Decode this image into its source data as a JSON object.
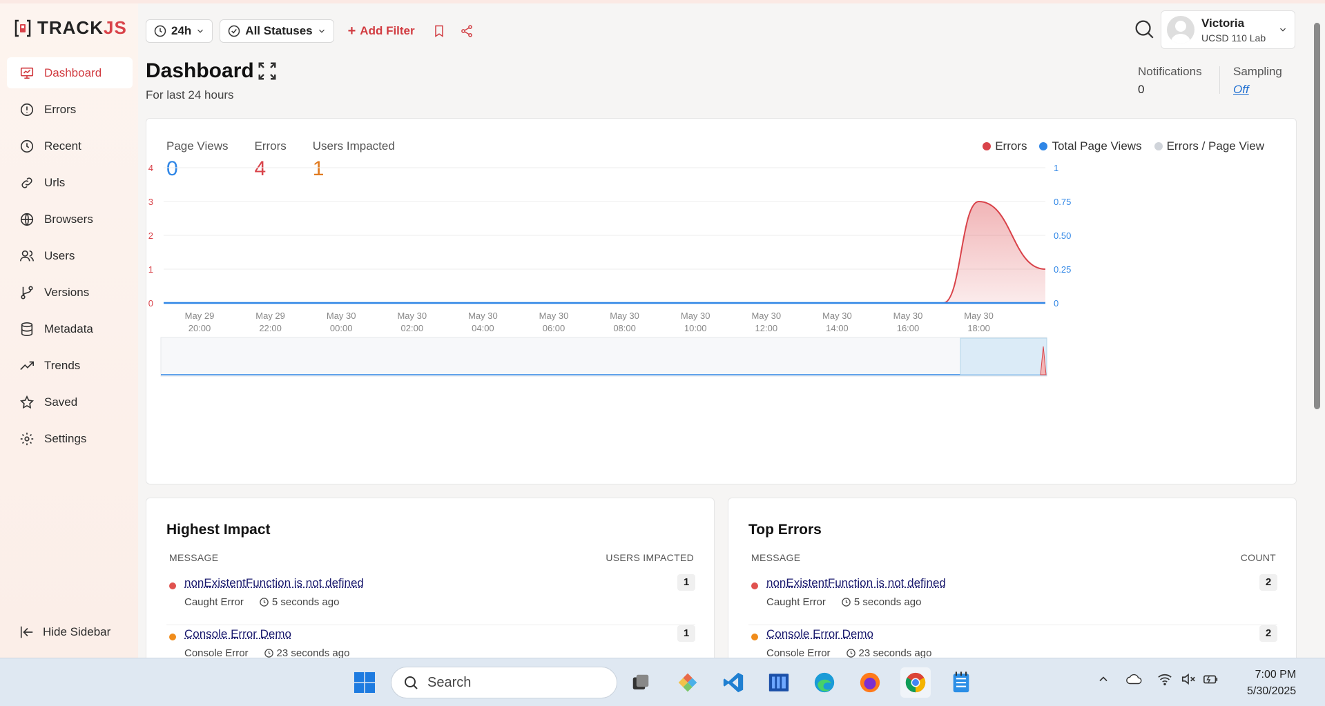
{
  "app": {
    "logo_text": "TRACK",
    "logo_text_accent": "JS"
  },
  "sidebar": {
    "items": [
      {
        "label": "Dashboard",
        "icon": "presentation-chart-icon",
        "active": true
      },
      {
        "label": "Errors",
        "icon": "alert-circle-icon",
        "active": false
      },
      {
        "label": "Recent",
        "icon": "clock-icon",
        "active": false
      },
      {
        "label": "Urls",
        "icon": "link-icon",
        "active": false
      },
      {
        "label": "Browsers",
        "icon": "globe-icon",
        "active": false
      },
      {
        "label": "Users",
        "icon": "users-icon",
        "active": false
      },
      {
        "label": "Versions",
        "icon": "git-branch-icon",
        "active": false
      },
      {
        "label": "Metadata",
        "icon": "database-icon",
        "active": false
      },
      {
        "label": "Trends",
        "icon": "trending-up-icon",
        "active": false
      },
      {
        "label": "Saved",
        "icon": "star-icon",
        "active": false
      },
      {
        "label": "Settings",
        "icon": "gear-icon",
        "active": false
      }
    ],
    "hide_label": "Hide Sidebar"
  },
  "toolbar": {
    "time_range": "24h",
    "status_filter": "All Statuses",
    "add_filter_label": "Add Filter"
  },
  "user": {
    "name": "Victoria",
    "org": "UCSD 110 Lab"
  },
  "header": {
    "title": "Dashboard",
    "subtitle": "For last 24 hours",
    "notifications_label": "Notifications",
    "notifications_value": "0",
    "sampling_label": "Sampling",
    "sampling_value": "Off"
  },
  "stats": {
    "page_views_label": "Page Views",
    "page_views_value": "0",
    "errors_label": "Errors",
    "errors_value": "4",
    "users_label": "Users Impacted",
    "users_value": "1"
  },
  "legend": {
    "errors": "Errors",
    "page_views": "Total Page Views",
    "ratio": "Errors / Page View"
  },
  "colors": {
    "accent": "#d13b40",
    "errors": "#d9434a",
    "page_views": "#2f86e6",
    "users": "#e07a1f",
    "ratio": "#d0d4da"
  },
  "chart_data": {
    "type": "area",
    "x": [
      "May 29 20:00",
      "May 29 22:00",
      "May 30 00:00",
      "May 30 02:00",
      "May 30 04:00",
      "May 30 06:00",
      "May 30 08:00",
      "May 30 10:00",
      "May 30 12:00",
      "May 30 14:00",
      "May 30 16:00",
      "May 30 17:00",
      "May 30 18:00",
      "May 30 19:00"
    ],
    "tick_labels": [
      {
        "top": "May 29",
        "bottom": "20:00"
      },
      {
        "top": "May 29",
        "bottom": "22:00"
      },
      {
        "top": "May 30",
        "bottom": "00:00"
      },
      {
        "top": "May 30",
        "bottom": "02:00"
      },
      {
        "top": "May 30",
        "bottom": "04:00"
      },
      {
        "top": "May 30",
        "bottom": "06:00"
      },
      {
        "top": "May 30",
        "bottom": "08:00"
      },
      {
        "top": "May 30",
        "bottom": "10:00"
      },
      {
        "top": "May 30",
        "bottom": "12:00"
      },
      {
        "top": "May 30",
        "bottom": "14:00"
      },
      {
        "top": "May 30",
        "bottom": "16:00"
      },
      {
        "top": "May 30",
        "bottom": "18:00"
      }
    ],
    "series": [
      {
        "name": "Errors",
        "axis": "left",
        "values": [
          0,
          0,
          0,
          0,
          0,
          0,
          0,
          0,
          0,
          0,
          0,
          0,
          3,
          1
        ]
      },
      {
        "name": "Total Page Views",
        "axis": "right",
        "values": [
          0,
          0,
          0,
          0,
          0,
          0,
          0,
          0,
          0,
          0,
          0,
          0,
          0,
          0
        ]
      }
    ],
    "y_left": {
      "ticks": [
        "0",
        "1",
        "2",
        "3",
        "4"
      ],
      "range": [
        0,
        4
      ]
    },
    "y_right": {
      "ticks": [
        "0",
        "0.25",
        "0.50",
        "0.75",
        "1"
      ],
      "range": [
        0,
        1
      ]
    },
    "grid": true,
    "legend_position": "top-right"
  },
  "highest_impact": {
    "title": "Highest Impact",
    "col_message": "MESSAGE",
    "col_value": "USERS IMPACTED",
    "rows": [
      {
        "message": "nonExistentFunction is not defined",
        "type": "Caught Error",
        "time": "5 seconds ago",
        "count": "1",
        "color": "#e0524f"
      },
      {
        "message": "Console Error Demo",
        "type": "Console Error",
        "time": "23 seconds ago",
        "count": "1",
        "color": "#f08c1a"
      }
    ]
  },
  "top_errors": {
    "title": "Top Errors",
    "col_message": "MESSAGE",
    "col_value": "COUNT",
    "rows": [
      {
        "message": "nonExistentFunction is not defined",
        "type": "Caught Error",
        "time": "5 seconds ago",
        "count": "2",
        "color": "#e0524f"
      },
      {
        "message": "Console Error Demo",
        "type": "Console Error",
        "time": "23 seconds ago",
        "count": "2",
        "color": "#f08c1a"
      }
    ]
  },
  "taskbar": {
    "search_placeholder": "Search",
    "time": "7:00 PM",
    "date": "5/30/2025"
  }
}
